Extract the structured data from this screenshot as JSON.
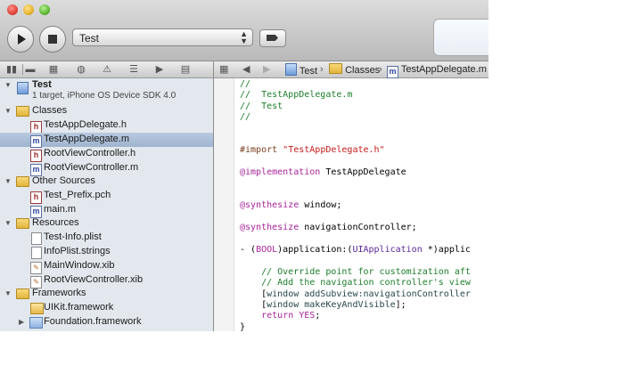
{
  "toolbar": {
    "scheme_label": "Test",
    "colors": {
      "close": "#e0443a",
      "minimize": "#e6b32c",
      "zoom": "#5cb833"
    }
  },
  "jump_bar": {
    "crumbs": [
      "Test",
      "Classes",
      "TestAppDelegate.m"
    ]
  },
  "sidebar": {
    "project": {
      "name": "Test",
      "subtitle": "1 target, iPhone OS Device SDK 4.0"
    },
    "items": [
      {
        "label": "Classes",
        "kind": "folder",
        "level": 1,
        "expanded": true
      },
      {
        "label": "TestAppDelegate.h",
        "kind": "h",
        "level": 2
      },
      {
        "label": "TestAppDelegate.m",
        "kind": "m",
        "level": 2,
        "selected": true
      },
      {
        "label": "RootViewController.h",
        "kind": "h",
        "level": 2
      },
      {
        "label": "RootViewController.m",
        "kind": "m",
        "level": 2
      },
      {
        "label": "Other Sources",
        "kind": "folder",
        "level": 1,
        "expanded": true
      },
      {
        "label": "Test_Prefix.pch",
        "kind": "h",
        "level": 2
      },
      {
        "label": "main.m",
        "kind": "m",
        "level": 2
      },
      {
        "label": "Resources",
        "kind": "folder",
        "level": 1,
        "expanded": true
      },
      {
        "label": "Test-Info.plist",
        "kind": "doc",
        "level": 2
      },
      {
        "label": "InfoPlist.strings",
        "kind": "doc",
        "level": 2
      },
      {
        "label": "MainWindow.xib",
        "kind": "xib",
        "level": 2
      },
      {
        "label": "RootViewController.xib",
        "kind": "xib",
        "level": 2
      },
      {
        "label": "Frameworks",
        "kind": "folder",
        "level": 1,
        "expanded": true
      },
      {
        "label": "UIKit.framework",
        "kind": "framework",
        "level": 2
      },
      {
        "label": "Foundation.framework",
        "kind": "framework",
        "level": 2,
        "collapsed": true
      }
    ]
  },
  "editor": {
    "lines": [
      {
        "text": "//",
        "style": "comment"
      },
      {
        "text": "//  TestAppDelegate.m",
        "style": "comment"
      },
      {
        "text": "//  Test",
        "style": "comment"
      },
      {
        "text": "//",
        "style": "comment"
      },
      {
        "text": "",
        "style": "plain"
      },
      {
        "text": "",
        "style": "plain"
      },
      {
        "text": "#import \"TestAppDelegate.h\"",
        "style": "import"
      },
      {
        "text": "",
        "style": "plain"
      },
      {
        "text": "@implementation TestAppDelegate",
        "style": "impl"
      },
      {
        "text": "",
        "style": "plain"
      },
      {
        "text": "",
        "style": "plain"
      },
      {
        "text": "@synthesize window;",
        "style": "synth"
      },
      {
        "text": "",
        "style": "plain"
      },
      {
        "text": "@synthesize navigationController;",
        "style": "synth"
      },
      {
        "text": "",
        "style": "plain"
      },
      {
        "text": "- (BOOL)application:(UIApplication *)applic",
        "style": "method"
      },
      {
        "text": "",
        "style": "plain"
      },
      {
        "text": "    // Override point for customization aft",
        "style": "comment"
      },
      {
        "text": "    // Add the navigation controller's view",
        "style": "comment"
      },
      {
        "text": "    [window addSubview:navigationController",
        "style": "msg1"
      },
      {
        "text": "    [window makeKeyAndVisible];",
        "style": "msg2"
      },
      {
        "text": "    return YES;",
        "style": "ret"
      },
      {
        "text": "}",
        "style": "plain"
      }
    ]
  }
}
